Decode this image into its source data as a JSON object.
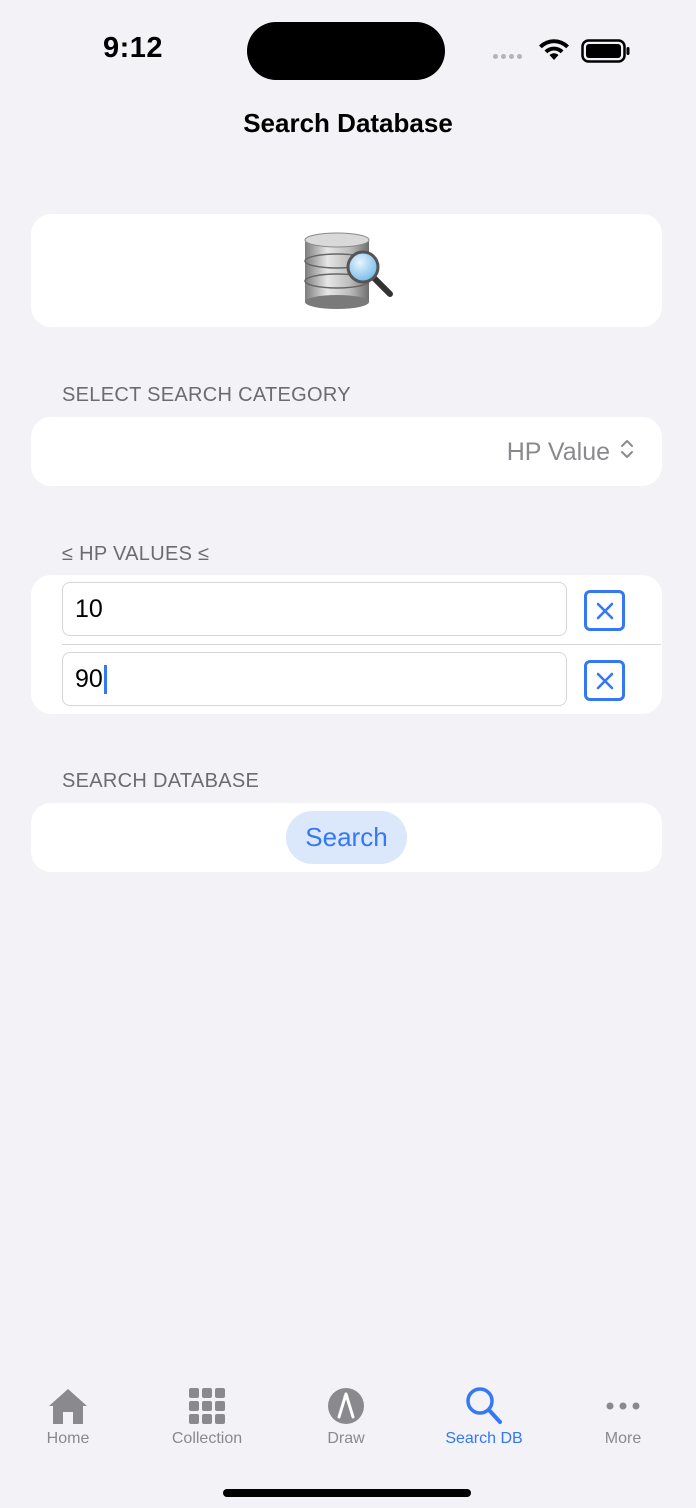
{
  "status": {
    "time": "9:12"
  },
  "nav": {
    "title": "Search Database"
  },
  "category": {
    "header": "SELECT SEARCH CATEGORY",
    "selected": "HP Value"
  },
  "hp": {
    "header": "≤ HP VALUES ≤",
    "min_value": "10",
    "max_value": "90"
  },
  "search": {
    "header": "SEARCH DATABASE",
    "button_label": "Search"
  },
  "tabs": [
    {
      "label": "Home",
      "icon": "house-icon"
    },
    {
      "label": "Collection",
      "icon": "grid-icon"
    },
    {
      "label": "Draw",
      "icon": "compass-icon"
    },
    {
      "label": "Search DB",
      "icon": "magnifier-icon"
    },
    {
      "label": "More",
      "icon": "ellipsis-icon"
    }
  ],
  "colors": {
    "accent": "#3478f6",
    "background": "#f2f2f7",
    "inactive": "#8a8a8e"
  }
}
